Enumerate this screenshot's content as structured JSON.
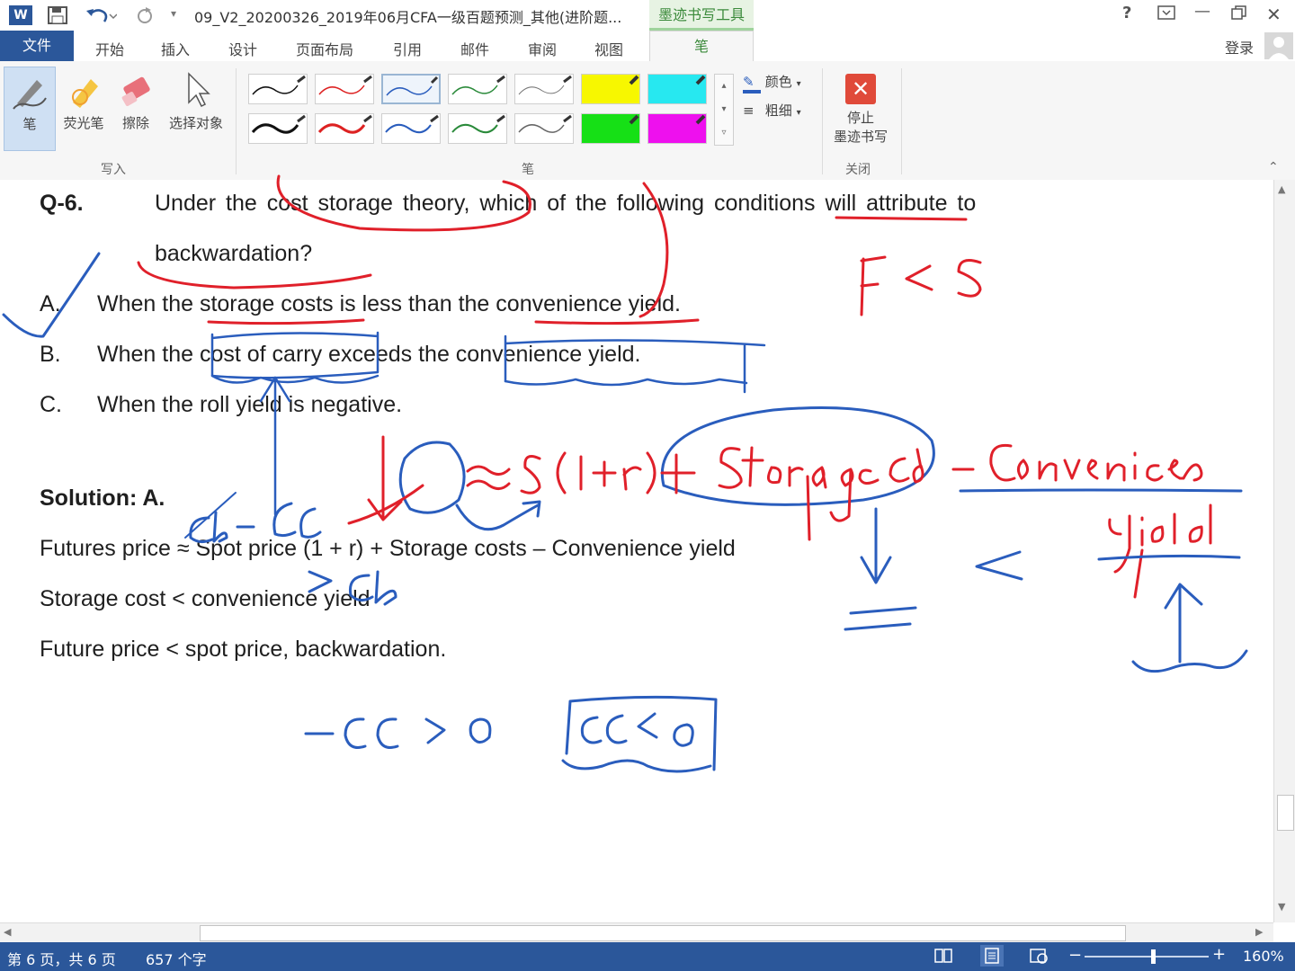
{
  "titlebar": {
    "doc_title": "09_V2_20200326_2019年06月CFA一级百题预测_其他(进阶题...",
    "tools_tab": "墨迹书写工具",
    "help": "?",
    "window_controls": [
      "minimize-icon",
      "restore-icon",
      "close-icon"
    ]
  },
  "ribbon": {
    "file_tab": "文件",
    "tabs": [
      "开始",
      "插入",
      "设计",
      "页面布局",
      "引用",
      "邮件",
      "审阅",
      "视图",
      "笔"
    ],
    "login": "登录",
    "write_group": {
      "label": "写入",
      "buttons": [
        "笔",
        "荧光笔",
        "擦除",
        "选择对象"
      ]
    },
    "pen_group": {
      "label": "笔",
      "color_label": "颜色",
      "weight_label": "粗细",
      "highlighter_colors": [
        "#f7f700",
        "#27e8f0",
        "#16e016",
        "#ee10ee"
      ]
    },
    "close_group": {
      "label": "关闭",
      "stop_line1": "停止",
      "stop_line2": "墨迹书写"
    }
  },
  "document": {
    "q_label": "Q-6.",
    "q_text_line1": "Under the cost storage theory, which of the following conditions will attribute to",
    "q_text_line2": "backwardation?",
    "options": [
      {
        "letter": "A.",
        "text": "When the storage costs is less than the convenience yield."
      },
      {
        "letter": "B.",
        "text": "When the cost of carry exceeds the convenience yield."
      },
      {
        "letter": "C.",
        "text": "When the roll yield is negative."
      }
    ],
    "solution_title": "Solution: A.",
    "solution_lines": [
      "Futures price ≈ Spot price (1 + r) + Storage costs – Convenience yield",
      "Storage cost < convenience yield",
      "Future price < spot price, backwardation."
    ]
  },
  "ink": {
    "red_color": "#e0202a",
    "blue_color": "#2a5dbd",
    "red_texts": [
      "F < S",
      "F",
      "≈",
      "S(1+r)",
      "+ Storage cost",
      "– Convenience",
      "yield"
    ],
    "blue_texts": [
      "CB – CC",
      "> CB",
      "–CC > 0",
      "CC < 0"
    ]
  },
  "statusbar": {
    "page_info": "第 6 页，共 6 页",
    "word_count": "657 个字",
    "zoom": "160%"
  }
}
